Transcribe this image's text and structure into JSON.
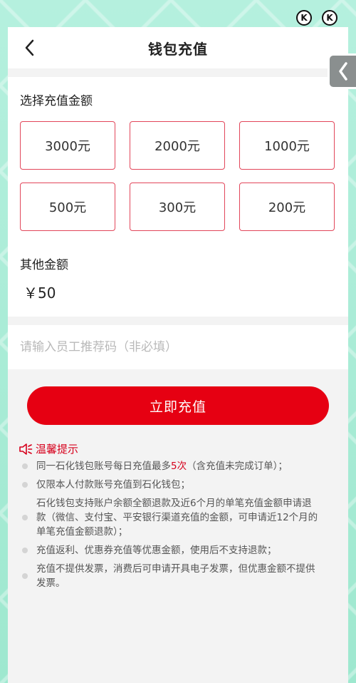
{
  "nav": {
    "title": "钱包充值"
  },
  "recharge": {
    "label": "选择充值金额",
    "amounts": [
      "3000元",
      "2000元",
      "1000元",
      "500元",
      "300元",
      "200元"
    ],
    "other_label": "其他金额",
    "other_value": "￥50"
  },
  "referral": {
    "placeholder": "请输入员工推荐码（非必填）"
  },
  "submit_label": "立即充值",
  "tips": {
    "title": "温馨提示",
    "item1_pre": "同一石化钱包账号每日充值最多",
    "item1_highlight": "5次",
    "item1_post": "（含充值未完成订单）；",
    "item2": "仅限本人付款账号充值到石化钱包；",
    "item3": "石化钱包支持账户余额全额退款及近6个月的单笔充值金额申请退款（微信、支付宝、平安银行渠道充值的金额，可申请近12个月的单笔充值金额退款）；",
    "item4": "充值返利、优惠券充值等优惠金额，使用后不支持退款；",
    "item5": "充值不提供发票，消费后可申请开具电子发票，但优惠金额不提供发票。"
  },
  "colors": {
    "accent": "#e60012",
    "border": "#e2465a",
    "background": "#a8ecd6"
  }
}
